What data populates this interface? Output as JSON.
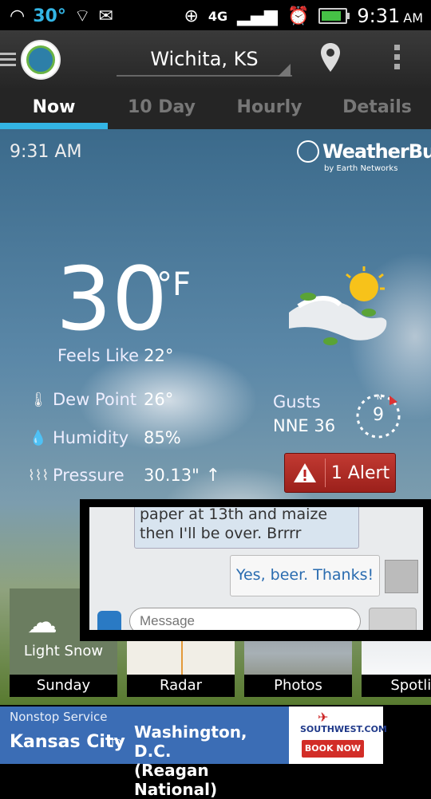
{
  "status_bar": {
    "temp": "30°",
    "network": "4G",
    "time": "9:31",
    "ampm": "AM"
  },
  "header": {
    "location": "Wichita, KS"
  },
  "tabs": [
    {
      "label": "Now",
      "active": true
    },
    {
      "label": "10 Day",
      "active": false
    },
    {
      "label": "Hourly",
      "active": false
    },
    {
      "label": "Details",
      "active": false
    }
  ],
  "weather": {
    "timestamp": "9:31 AM",
    "brand": "WeatherBug",
    "brand_sub": "by Earth Networks",
    "temperature": "30",
    "unit": "°F",
    "feels_like_label": "Feels Like",
    "feels_like_value": "22°",
    "dew_point_label": "Dew Point",
    "dew_point_value": "26°",
    "humidity_label": "Humidity",
    "humidity_value": "85%",
    "pressure_label": "Pressure",
    "pressure_value": "30.13\"",
    "gusts_label": "Gusts",
    "gusts_value": "NNE 36",
    "wind_speed": "9",
    "compass_n": "N",
    "alert_label": "1 Alert"
  },
  "tiles": [
    {
      "caption": "Sunday",
      "condition": "Light Snow"
    },
    {
      "caption": "Radar"
    },
    {
      "caption": "Photos"
    },
    {
      "caption": "Spotlig"
    }
  ],
  "chat": {
    "incoming": "paper at 13th and maize then I'll be over. Brrrr",
    "outgoing": "Yes, beer. Thanks!",
    "placeholder": "Message"
  },
  "ad": {
    "line1": "Nonstop Service",
    "origin": "Kansas City",
    "to": "TO",
    "destination": "Washington, D.C.",
    "destination2": "(Reagan National)",
    "brand": "SOUTHWEST.COM",
    "cta": "BOOK NOW"
  }
}
